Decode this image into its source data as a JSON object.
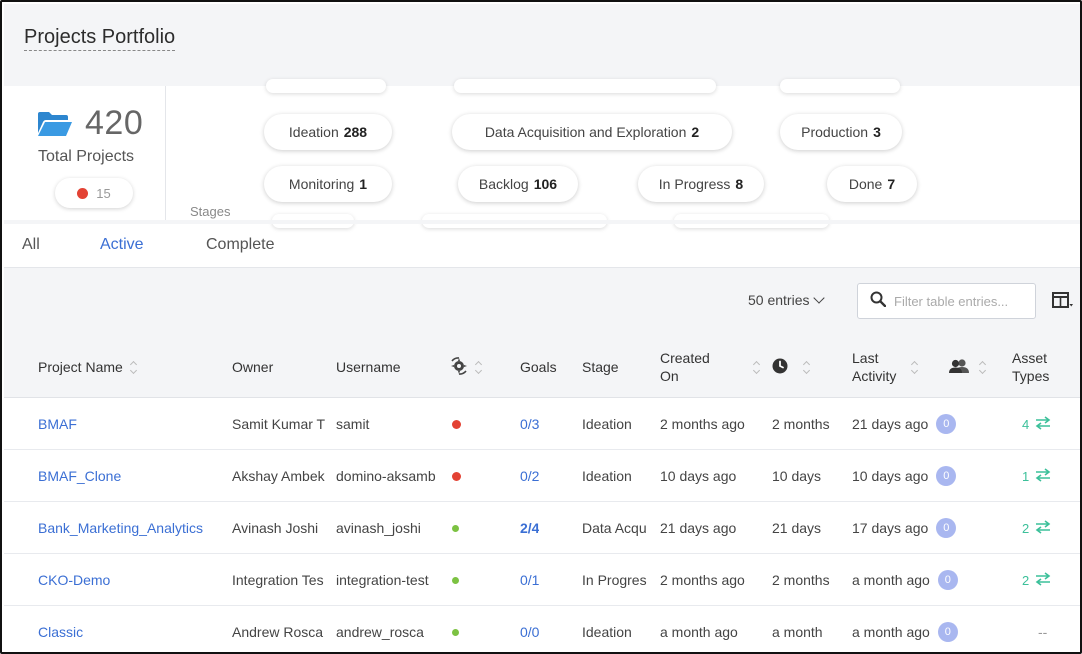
{
  "page": {
    "title": "Projects Portfolio"
  },
  "summary": {
    "total_count": "420",
    "total_label": "Total Projects",
    "flagged_count": "15",
    "stages_label": "Stages",
    "stages": [
      {
        "name": "Ideation",
        "count": "288"
      },
      {
        "name": "Data Acquisition and Exploration",
        "count": "2"
      },
      {
        "name": "Production",
        "count": "3"
      },
      {
        "name": "Monitoring",
        "count": "1"
      },
      {
        "name": "Backlog",
        "count": "106"
      },
      {
        "name": "In Progress",
        "count": "8"
      },
      {
        "name": "Done",
        "count": "7"
      }
    ]
  },
  "tabs": [
    {
      "label": "All",
      "active": false
    },
    {
      "label": "Active",
      "active": true
    },
    {
      "label": "Complete",
      "active": false
    }
  ],
  "toolbar": {
    "entries_label": "50 entries",
    "filter_placeholder": "Filter table entries..."
  },
  "table": {
    "headers": {
      "project_name": "Project Name",
      "owner": "Owner",
      "username": "Username",
      "goals": "Goals",
      "stage": "Stage",
      "created_on_1": "Created",
      "created_on_2": "On",
      "last_activity_1": "Last",
      "last_activity_2": "Activity",
      "asset_types_1": "Asset",
      "asset_types_2": "Types"
    },
    "rows": [
      {
        "project": "BMAF",
        "owner": "Samit Kumar T",
        "username": "samit",
        "status": "red",
        "goals": "0/3",
        "goals_strong": false,
        "stage": "Ideation",
        "created": "2 months ago",
        "duration": "2 months",
        "last_activity": "21 days ago",
        "collaborators": "0",
        "assets": "4"
      },
      {
        "project": "BMAF_Clone",
        "owner": "Akshay Ambek",
        "username": "domino-aksamb",
        "status": "red",
        "goals": "0/2",
        "goals_strong": false,
        "stage": "Ideation",
        "created": "10 days ago",
        "duration": "10 days",
        "last_activity": "10 days ago",
        "collaborators": "0",
        "assets": "1"
      },
      {
        "project": "Bank_Marketing_Analytics",
        "owner": "Avinash Joshi",
        "username": "avinash_joshi",
        "status": "green",
        "goals": "2/4",
        "goals_strong": true,
        "stage": "Data Acqu",
        "created": "21 days ago",
        "duration": "21 days",
        "last_activity": "17 days ago",
        "collaborators": "0",
        "assets": "2"
      },
      {
        "project": "CKO-Demo",
        "owner": "Integration Tes",
        "username": "integration-test",
        "status": "green",
        "goals": "0/1",
        "goals_strong": false,
        "stage": "In Progres",
        "created": "2 months ago",
        "duration": "2 months",
        "last_activity": "a month ago",
        "collaborators": "0",
        "assets": "2"
      },
      {
        "project": "Classic",
        "owner": "Andrew Rosca",
        "username": "andrew_rosca",
        "status": "green",
        "goals": "0/0",
        "goals_strong": false,
        "stage": "Ideation",
        "created": "a month ago",
        "duration": "a month",
        "last_activity": "a month ago",
        "collaborators": "0",
        "assets": "--"
      }
    ]
  },
  "colors": {
    "accent": "#3b6fd4",
    "status_red": "#e34234",
    "status_green": "#7cc242",
    "asset_green": "#3cc09a",
    "badge": "#a9b7f0"
  },
  "icons": {
    "total": "folder-open-icon",
    "search": "search-icon",
    "columns": "columns-icon",
    "status_header": "status-gear-icon",
    "duration_header": "clock-icon",
    "collaborators_header": "collaborators-icon",
    "assets": "swap-arrows-icon"
  }
}
